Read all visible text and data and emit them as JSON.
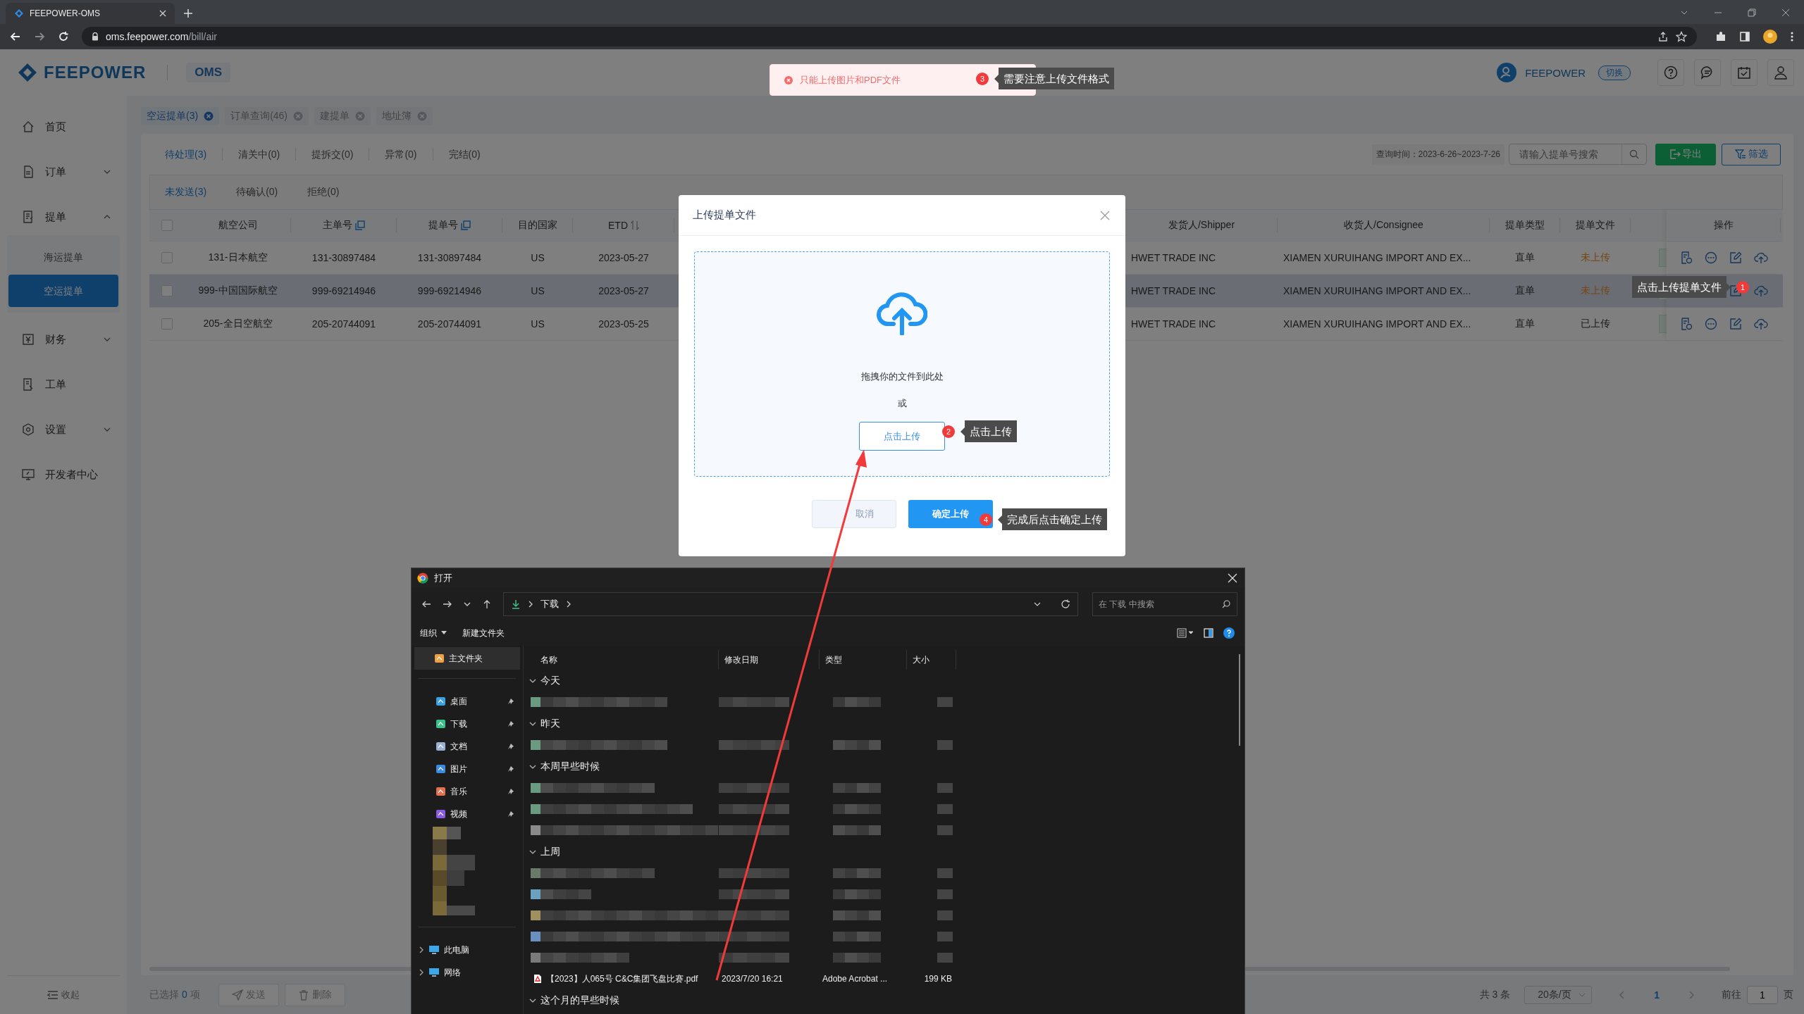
{
  "browser": {
    "tab_title": "FEEPOWER-OMS",
    "url_host": "oms.feepower.com",
    "url_path": "/bill/air"
  },
  "header": {
    "logo": "FEEPOWER",
    "product": "OMS",
    "user": "FEEPOWER",
    "switch_label": "切换"
  },
  "sidebar": {
    "items": [
      {
        "label": "首页"
      },
      {
        "label": "订单",
        "expanded": false
      },
      {
        "label": "提单",
        "expanded": true,
        "children": [
          {
            "label": "海运提单",
            "selected": false
          },
          {
            "label": "空运提单",
            "selected": true
          }
        ]
      },
      {
        "label": "财务",
        "expanded": false
      },
      {
        "label": "工单"
      },
      {
        "label": "设置",
        "expanded": false
      },
      {
        "label": "开发者中心"
      }
    ],
    "collapse": "收起"
  },
  "page_tags": [
    {
      "label": "空运提单(3)",
      "selected": true
    },
    {
      "label": "订单查询(46)",
      "selected": false
    },
    {
      "label": "建提单",
      "selected": false
    },
    {
      "label": "地址簿",
      "selected": false
    }
  ],
  "status_tabs": [
    {
      "label": "待处理(3)",
      "selected": true
    },
    {
      "label": "清关中(0)",
      "selected": false
    },
    {
      "label": "提拆交(0)",
      "selected": false
    },
    {
      "label": "异常(0)",
      "selected": false
    },
    {
      "label": "完结(0)",
      "selected": false
    }
  ],
  "query_time": "查询时间：2023-6-26~2023-7-26",
  "search": {
    "placeholder": "请输入提单号搜索"
  },
  "export_button": "导出",
  "filter_button": "筛选",
  "sub_tabs": [
    {
      "label": "未发送(3)",
      "selected": true
    },
    {
      "label": "待确认(0)",
      "selected": false
    },
    {
      "label": "拒绝(0)",
      "selected": false
    }
  ],
  "table": {
    "all_checked": false,
    "columns": [
      "航空公司",
      "主单号",
      "提单号",
      "目的国家",
      "ETD",
      "发货人/Shipper",
      "收货人/Consignee",
      "提单类型",
      "提单文件",
      "操作"
    ],
    "rows": [
      {
        "highlighted": false,
        "checked": false,
        "cells": [
          "131-日本航空",
          "131-30897484",
          "131-30897484",
          "US",
          "2023-05-27",
          "HWET TRADE INC",
          "XIAMEN XURUIHANG IMPORT AND EX...",
          "直单"
        ],
        "file_status": "未上传",
        "file_uploaded": false
      },
      {
        "highlighted": true,
        "checked": false,
        "cells": [
          "999-中国国际航空",
          "999-69214946",
          "999-69214946",
          "US",
          "2023-05-27",
          "HWET TRADE INC",
          "XIAMEN XURUIHANG IMPORT AND EX...",
          "直单"
        ],
        "file_status": "未上传",
        "file_uploaded": false
      },
      {
        "highlighted": false,
        "checked": false,
        "cells": [
          "205-全日空航空",
          "205-20744091",
          "205-20744091",
          "US",
          "2023-05-25",
          "HWET TRADE INC",
          "XIAMEN XURUIHANG IMPORT AND EX...",
          "直单"
        ],
        "file_status": "已上传",
        "file_uploaded": true
      }
    ]
  },
  "footer": {
    "selected_prefix": "已选择",
    "selected_count": "0",
    "selected_suffix": "项",
    "send_button": "发送",
    "delete_button": "删除",
    "total": "共 3 条",
    "page_size": "20条/页",
    "current_page": "1",
    "goto_label": "前往",
    "goto_value": "1",
    "page_unit": "页"
  },
  "toast": {
    "message": "只能上传图片和PDF文件"
  },
  "annotations": [
    {
      "number": "1",
      "text": "点击上传提单文件"
    },
    {
      "number": "2",
      "text": "点击上传"
    },
    {
      "number": "3",
      "text": "需要注意上传文件格式"
    },
    {
      "number": "4",
      "text": "完成后点击确定上传"
    }
  ],
  "modal": {
    "title": "上传提单文件",
    "drop_hint": "拖拽你的文件到此处",
    "or": "或",
    "upload_button": "点击上传",
    "cancel_button": "取消",
    "confirm_button": "确定上传"
  },
  "file_dialog": {
    "title": "打开",
    "path": "下载",
    "search": {
      "placeholder": "在 下载 中搜索"
    },
    "toolbar": [
      "组织",
      "新建文件夹"
    ],
    "nav": [
      {
        "label": "主文件夹",
        "selected": true,
        "pinned": false
      },
      {
        "label": "桌面",
        "selected": false,
        "pinned": true
      },
      {
        "label": "下载",
        "selected": false,
        "pinned": true
      },
      {
        "label": "文档",
        "selected": false,
        "pinned": true
      },
      {
        "label": "图片",
        "selected": false,
        "pinned": true
      },
      {
        "label": "音乐",
        "selected": false,
        "pinned": true
      },
      {
        "label": "视频",
        "selected": false,
        "pinned": true
      }
    ],
    "nav_bottom": [
      "此电脑",
      "网络"
    ],
    "columns": [
      "名称",
      "修改日期",
      "类型",
      "大小"
    ],
    "groups": [
      {
        "label": "今天",
        "files": [
          {
            "kind": "blurred"
          }
        ]
      },
      {
        "label": "昨天",
        "files": [
          {
            "kind": "blurred"
          }
        ]
      },
      {
        "label": "本周早些时候",
        "files": [
          {
            "kind": "blurred"
          },
          {
            "kind": "blurred"
          },
          {
            "kind": "blurred"
          }
        ]
      },
      {
        "label": "上周",
        "files": [
          {
            "kind": "blurred"
          },
          {
            "kind": "blurred"
          },
          {
            "kind": "blurred"
          },
          {
            "kind": "blurred"
          },
          {
            "kind": "blurred"
          },
          {
            "kind": "file",
            "name": "【2023】人065号 C&C集团飞盘比赛.pdf",
            "modified": "2023/7/20 16:21",
            "type": "Adobe Acrobat ...",
            "size": "199 KB"
          }
        ]
      },
      {
        "label": "这个月的早些时候"
      }
    ]
  }
}
